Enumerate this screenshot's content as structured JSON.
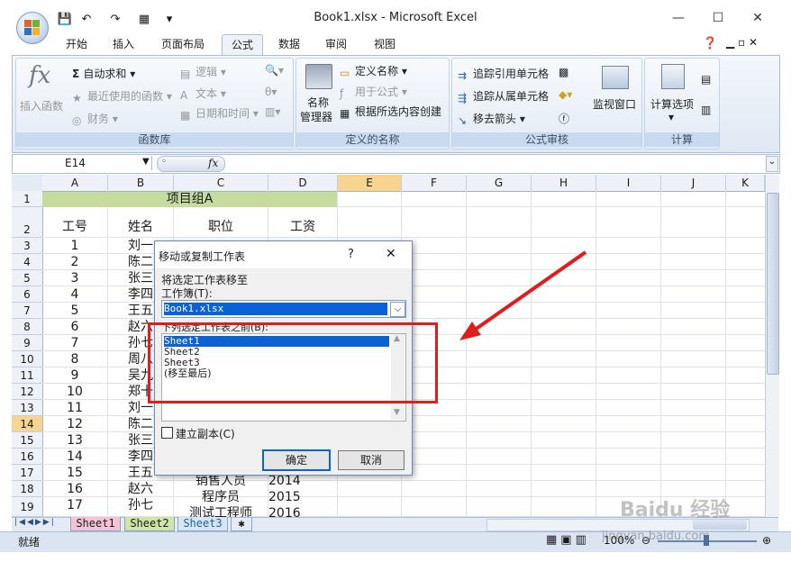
{
  "window": {
    "title": "Book1.xlsx - Microsoft Excel",
    "controls": {
      "minimize": "—",
      "maximize": "☐",
      "close": "✕"
    },
    "qat": {
      "save": "💾",
      "undo": "↶",
      "redo": "↷",
      "extra": "▦",
      "more": "▾"
    }
  },
  "ribbon_tabs": [
    "开始",
    "插入",
    "页面布局",
    "公式",
    "数据",
    "审阅",
    "视图"
  ],
  "active_tab": "公式",
  "ribbon": {
    "function_library": {
      "label": "函数库",
      "insert_function": "插入函数",
      "autosum": "自动求和",
      "recent": "最近使用的函数",
      "finance": "财务",
      "logic": "逻辑",
      "text": "文本",
      "datetime": "日期和时间"
    },
    "defined_names": {
      "label": "定义的名称",
      "name_manager_1": "名称",
      "name_manager_2": "管理器",
      "define_name": "定义名称",
      "use_in_formula": "用于公式",
      "create_from_selection": "根据所选内容创建"
    },
    "formula_auditing": {
      "label": "公式审核",
      "trace_precedents": "追踪引用单元格",
      "trace_dependents": "追踪从属单元格",
      "remove_arrows": "移去箭头",
      "watch_window": "监视窗口"
    },
    "calculation": {
      "label": "计算",
      "calc_options": "计算选项"
    }
  },
  "formula_bar": {
    "name_box": "E14",
    "fx": "fx",
    "value": ""
  },
  "columns": [
    "A",
    "B",
    "C",
    "D",
    "E",
    "F",
    "G",
    "H",
    "I",
    "J",
    "K"
  ],
  "active_column": "E",
  "rows": [
    "1",
    "2",
    "3",
    "4",
    "5",
    "6",
    "7",
    "8",
    "9",
    "10",
    "11",
    "12",
    "13",
    "14",
    "15",
    "16",
    "17",
    "18",
    "19"
  ],
  "active_row": "14",
  "cells": {
    "title": "项目组A",
    "header_id": "工号",
    "header_name": "姓名",
    "header_position": "职位",
    "header_salary": "工资",
    "ids": [
      "1",
      "2",
      "3",
      "4",
      "5",
      "6",
      "7",
      "8",
      "9",
      "10",
      "11",
      "12",
      "13",
      "14",
      "15",
      "16",
      "17"
    ],
    "names": [
      "刘一",
      "陈二",
      "张三",
      "李四",
      "王五",
      "赵六",
      "孙七",
      "周八",
      "吴九",
      "郑十",
      "刘一",
      "陈二",
      "张三",
      "李四",
      "王五",
      "赵六",
      "孙七"
    ],
    "row17": {
      "position": "销售人员",
      "salary": "2014"
    },
    "row18": {
      "position": "程序员",
      "salary": "2015"
    },
    "row19": {
      "position": "测试工程师",
      "salary": "2016"
    }
  },
  "dialog": {
    "title": "移动或复制工作表",
    "help": "?",
    "close": "✕",
    "move_to_label": "将选定工作表移至",
    "workbook_label": "工作簿(T):",
    "workbook_value": "Book1.xlsx",
    "before_label": "下列选定工作表之前(B):",
    "sheet_list": [
      "Sheet1",
      "Sheet2",
      "Sheet3",
      "(移至最后)"
    ],
    "selected_sheet": "Sheet1",
    "create_copy": "建立副本(C)",
    "create_copy_checked": false,
    "ok": "确定",
    "cancel": "取消"
  },
  "sheet_tabs": [
    "Sheet1",
    "Sheet2",
    "Sheet3"
  ],
  "sheet_tab_colors": {
    "Sheet1": "#f4c4d6",
    "Sheet2": "#cfe5a8",
    "Sheet3": "#d7e6f7"
  },
  "status": {
    "ready": "就绪",
    "zoom": "100%"
  },
  "watermark": {
    "brand": "Baidu 经验",
    "url": "jingyan.baidu.com"
  },
  "annotation_color": "#e21b1b"
}
